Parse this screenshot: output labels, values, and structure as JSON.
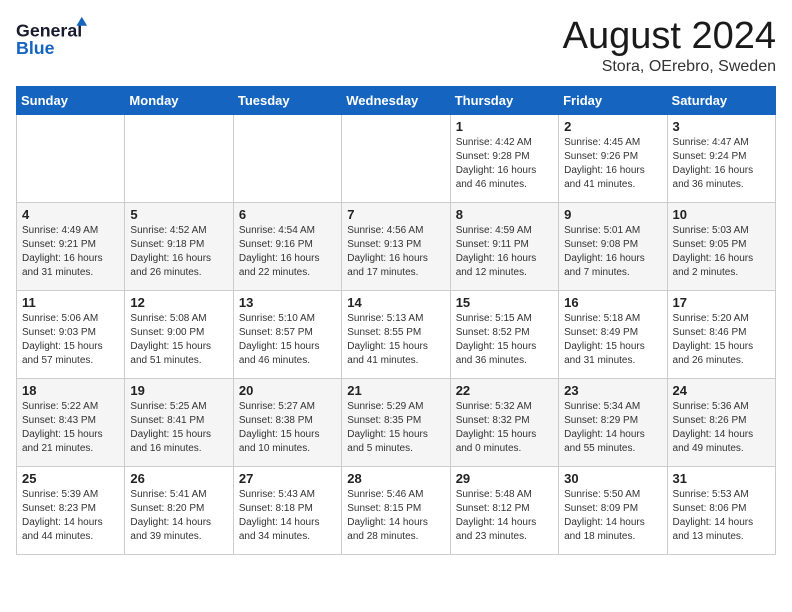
{
  "header": {
    "logo_line1": "General",
    "logo_line2": "Blue",
    "month": "August 2024",
    "location": "Stora, OErebro, Sweden"
  },
  "weekdays": [
    "Sunday",
    "Monday",
    "Tuesday",
    "Wednesday",
    "Thursday",
    "Friday",
    "Saturday"
  ],
  "weeks": [
    [
      {
        "day": "",
        "info": ""
      },
      {
        "day": "",
        "info": ""
      },
      {
        "day": "",
        "info": ""
      },
      {
        "day": "",
        "info": ""
      },
      {
        "day": "1",
        "info": "Sunrise: 4:42 AM\nSunset: 9:28 PM\nDaylight: 16 hours\nand 46 minutes."
      },
      {
        "day": "2",
        "info": "Sunrise: 4:45 AM\nSunset: 9:26 PM\nDaylight: 16 hours\nand 41 minutes."
      },
      {
        "day": "3",
        "info": "Sunrise: 4:47 AM\nSunset: 9:24 PM\nDaylight: 16 hours\nand 36 minutes."
      }
    ],
    [
      {
        "day": "4",
        "info": "Sunrise: 4:49 AM\nSunset: 9:21 PM\nDaylight: 16 hours\nand 31 minutes."
      },
      {
        "day": "5",
        "info": "Sunrise: 4:52 AM\nSunset: 9:18 PM\nDaylight: 16 hours\nand 26 minutes."
      },
      {
        "day": "6",
        "info": "Sunrise: 4:54 AM\nSunset: 9:16 PM\nDaylight: 16 hours\nand 22 minutes."
      },
      {
        "day": "7",
        "info": "Sunrise: 4:56 AM\nSunset: 9:13 PM\nDaylight: 16 hours\nand 17 minutes."
      },
      {
        "day": "8",
        "info": "Sunrise: 4:59 AM\nSunset: 9:11 PM\nDaylight: 16 hours\nand 12 minutes."
      },
      {
        "day": "9",
        "info": "Sunrise: 5:01 AM\nSunset: 9:08 PM\nDaylight: 16 hours\nand 7 minutes."
      },
      {
        "day": "10",
        "info": "Sunrise: 5:03 AM\nSunset: 9:05 PM\nDaylight: 16 hours\nand 2 minutes."
      }
    ],
    [
      {
        "day": "11",
        "info": "Sunrise: 5:06 AM\nSunset: 9:03 PM\nDaylight: 15 hours\nand 57 minutes."
      },
      {
        "day": "12",
        "info": "Sunrise: 5:08 AM\nSunset: 9:00 PM\nDaylight: 15 hours\nand 51 minutes."
      },
      {
        "day": "13",
        "info": "Sunrise: 5:10 AM\nSunset: 8:57 PM\nDaylight: 15 hours\nand 46 minutes."
      },
      {
        "day": "14",
        "info": "Sunrise: 5:13 AM\nSunset: 8:55 PM\nDaylight: 15 hours\nand 41 minutes."
      },
      {
        "day": "15",
        "info": "Sunrise: 5:15 AM\nSunset: 8:52 PM\nDaylight: 15 hours\nand 36 minutes."
      },
      {
        "day": "16",
        "info": "Sunrise: 5:18 AM\nSunset: 8:49 PM\nDaylight: 15 hours\nand 31 minutes."
      },
      {
        "day": "17",
        "info": "Sunrise: 5:20 AM\nSunset: 8:46 PM\nDaylight: 15 hours\nand 26 minutes."
      }
    ],
    [
      {
        "day": "18",
        "info": "Sunrise: 5:22 AM\nSunset: 8:43 PM\nDaylight: 15 hours\nand 21 minutes."
      },
      {
        "day": "19",
        "info": "Sunrise: 5:25 AM\nSunset: 8:41 PM\nDaylight: 15 hours\nand 16 minutes."
      },
      {
        "day": "20",
        "info": "Sunrise: 5:27 AM\nSunset: 8:38 PM\nDaylight: 15 hours\nand 10 minutes."
      },
      {
        "day": "21",
        "info": "Sunrise: 5:29 AM\nSunset: 8:35 PM\nDaylight: 15 hours\nand 5 minutes."
      },
      {
        "day": "22",
        "info": "Sunrise: 5:32 AM\nSunset: 8:32 PM\nDaylight: 15 hours\nand 0 minutes."
      },
      {
        "day": "23",
        "info": "Sunrise: 5:34 AM\nSunset: 8:29 PM\nDaylight: 14 hours\nand 55 minutes."
      },
      {
        "day": "24",
        "info": "Sunrise: 5:36 AM\nSunset: 8:26 PM\nDaylight: 14 hours\nand 49 minutes."
      }
    ],
    [
      {
        "day": "25",
        "info": "Sunrise: 5:39 AM\nSunset: 8:23 PM\nDaylight: 14 hours\nand 44 minutes."
      },
      {
        "day": "26",
        "info": "Sunrise: 5:41 AM\nSunset: 8:20 PM\nDaylight: 14 hours\nand 39 minutes."
      },
      {
        "day": "27",
        "info": "Sunrise: 5:43 AM\nSunset: 8:18 PM\nDaylight: 14 hours\nand 34 minutes."
      },
      {
        "day": "28",
        "info": "Sunrise: 5:46 AM\nSunset: 8:15 PM\nDaylight: 14 hours\nand 28 minutes."
      },
      {
        "day": "29",
        "info": "Sunrise: 5:48 AM\nSunset: 8:12 PM\nDaylight: 14 hours\nand 23 minutes."
      },
      {
        "day": "30",
        "info": "Sunrise: 5:50 AM\nSunset: 8:09 PM\nDaylight: 14 hours\nand 18 minutes."
      },
      {
        "day": "31",
        "info": "Sunrise: 5:53 AM\nSunset: 8:06 PM\nDaylight: 14 hours\nand 13 minutes."
      }
    ]
  ]
}
